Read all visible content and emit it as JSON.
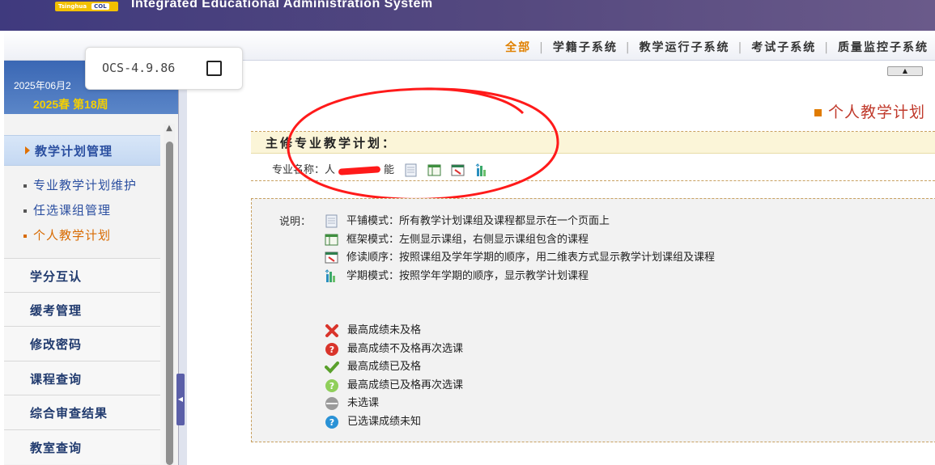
{
  "header": {
    "logo_text": "Tsinghua",
    "logo_badge": "COL",
    "system_title": "Integrated Educational Administration System"
  },
  "nav": {
    "items": [
      {
        "label": "全部",
        "active": true
      },
      {
        "label": "学籍子系统",
        "active": false
      },
      {
        "label": "教学运行子系统",
        "active": false
      },
      {
        "label": "考试子系统",
        "active": false
      },
      {
        "label": "质量监控子系统",
        "active": false
      }
    ],
    "separator": "|"
  },
  "popup": {
    "text": "OCS-4.9.86"
  },
  "sidebar": {
    "date": "2025年06月2",
    "week": "2025春 第18周",
    "active_menu": "教学计划管理",
    "submenu": [
      {
        "label": "专业教学计划维护",
        "active": false
      },
      {
        "label": "任选课组管理",
        "active": false
      },
      {
        "label": "个人教学计划",
        "active": true
      }
    ],
    "menu": [
      {
        "label": "学分互认"
      },
      {
        "label": "缓考管理"
      },
      {
        "label": "修改密码"
      },
      {
        "label": "课程查询"
      },
      {
        "label": "综合审查结果"
      },
      {
        "label": "教室查询"
      }
    ]
  },
  "content": {
    "page_title": "个人教学计划",
    "plan_heading": "主修专业教学计划：",
    "major_label": "专业名称：",
    "major_value_partial": "人",
    "major_value_tail": "能",
    "note_label": "说明：",
    "modes": [
      {
        "icon": "tile-mode-icon",
        "text": "平铺模式：所有教学计划课组及课程都显示在一个页面上"
      },
      {
        "icon": "frame-mode-icon",
        "text": "框架模式：左侧显示课组，右侧显示课组包含的课程"
      },
      {
        "icon": "study-order-icon",
        "text": "修读顺序：按照课组及学年学期的顺序，用二维表方式显示教学计划课组及课程"
      },
      {
        "icon": "semester-mode-icon",
        "text": "学期模式：按照学年学期的顺序，显示教学计划课程"
      }
    ],
    "statuses": [
      {
        "icon": "red-cross-icon",
        "text": "最高成绩未及格"
      },
      {
        "icon": "red-question-icon",
        "text": "最高成绩不及格再次选课"
      },
      {
        "icon": "green-check-icon",
        "text": "最高成绩已及格"
      },
      {
        "icon": "green-question-icon",
        "text": "最高成绩已及格再次选课"
      },
      {
        "icon": "gray-ball-icon",
        "text": "未选课"
      },
      {
        "icon": "blue-question-icon",
        "text": "已选课成绩未知"
      }
    ]
  },
  "colors": {
    "banner": "#3f3a7e",
    "active_nav": "#e08000",
    "title_red": "#c0392b",
    "sidebar_blue": "#3a67b4",
    "week_yellow": "#f5d000",
    "annotation_red": "#ff1a1a"
  }
}
